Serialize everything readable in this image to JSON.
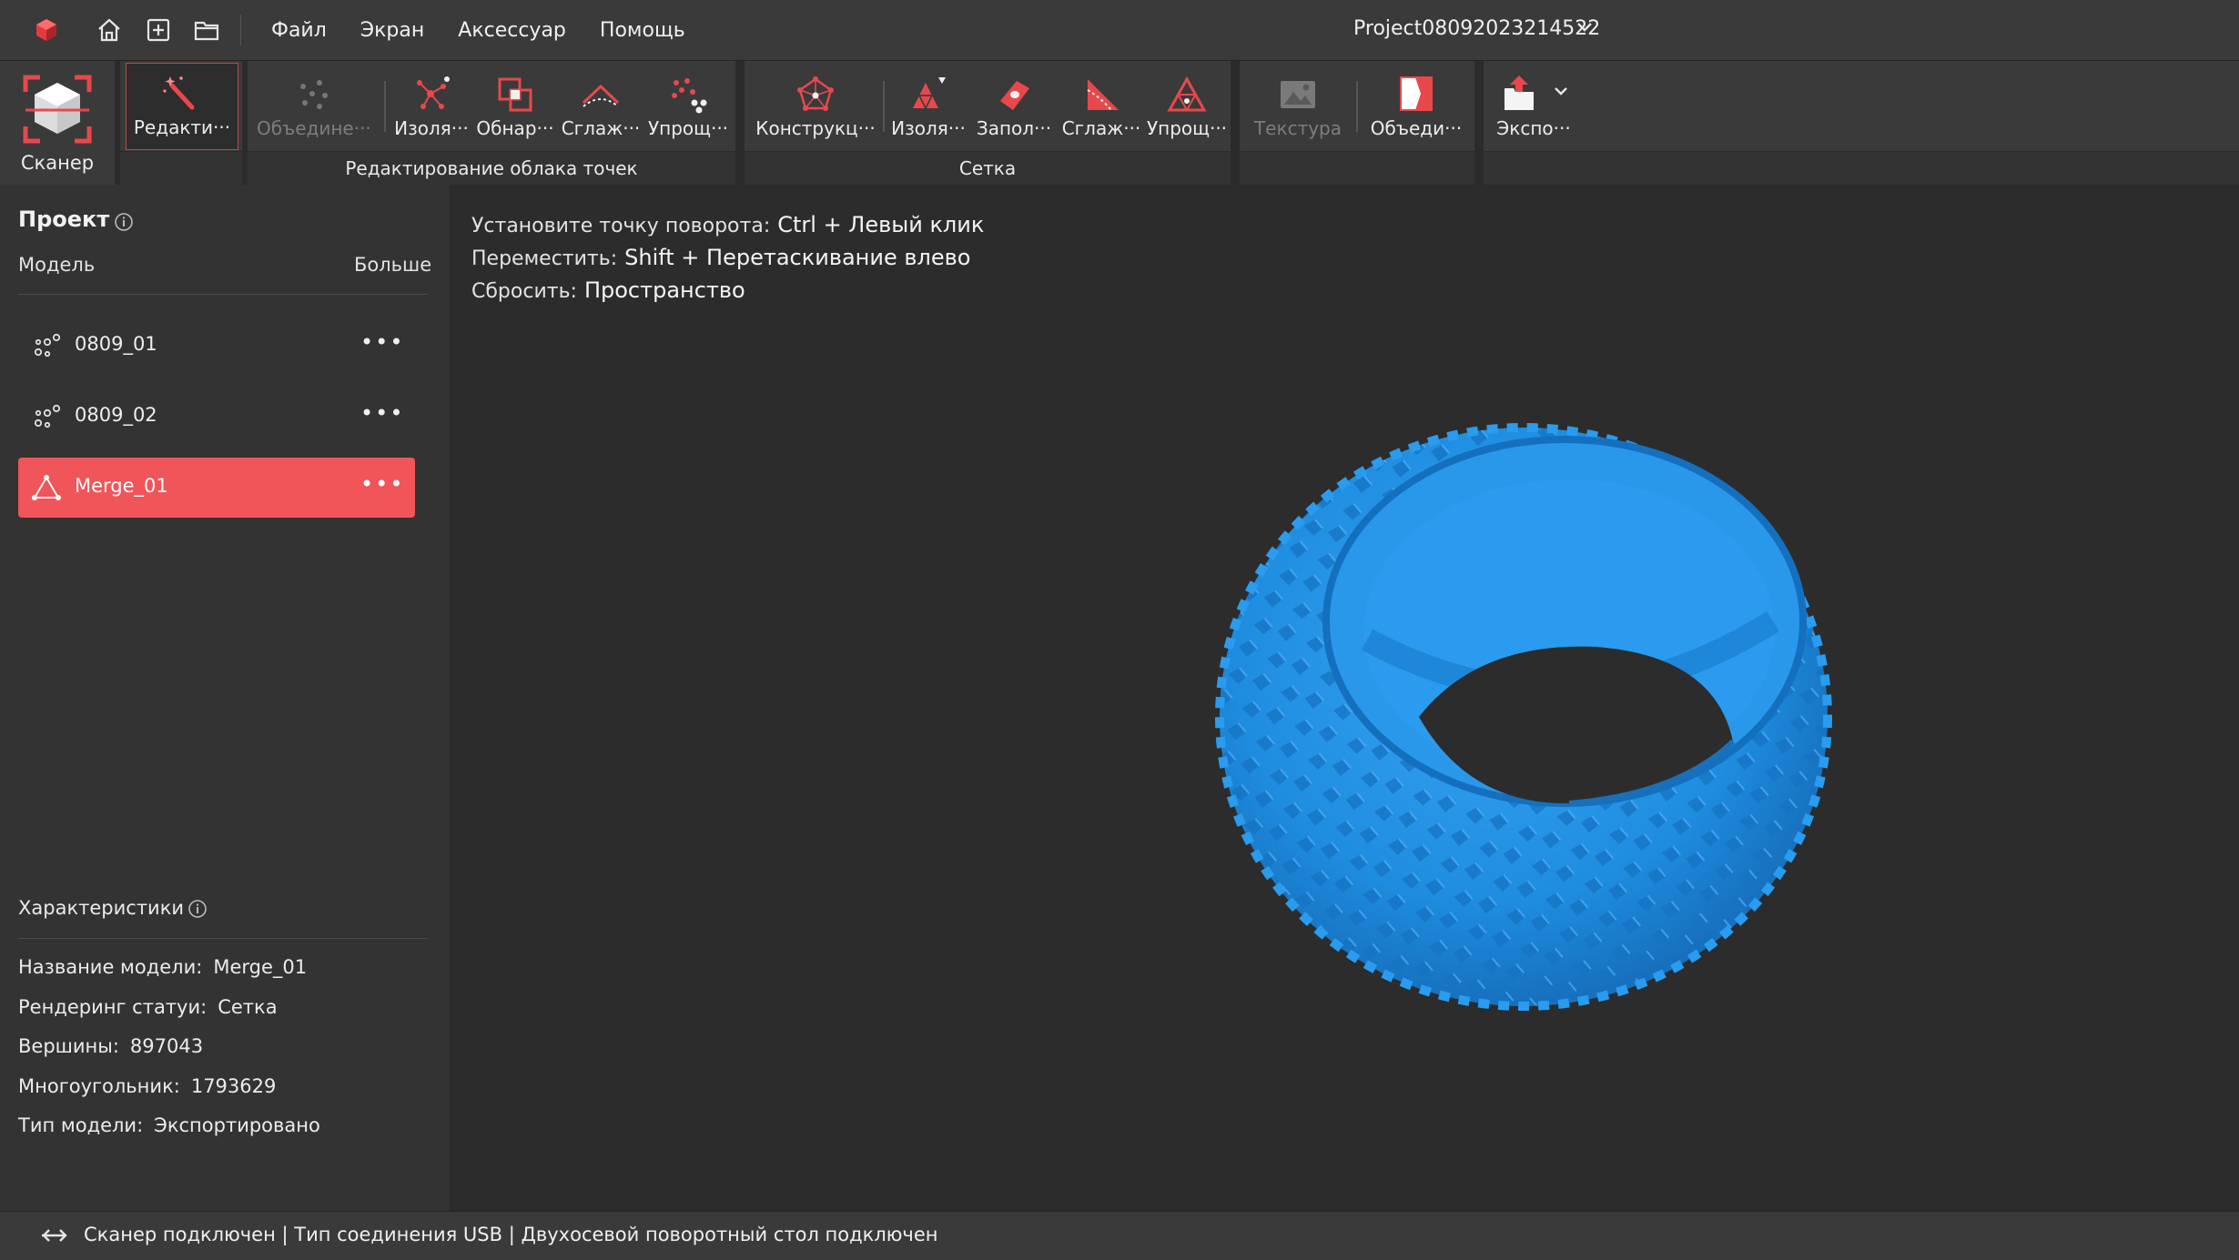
{
  "titlebar": {
    "menu": [
      "Файл",
      "Экран",
      "Аксессуар",
      "Помощь"
    ],
    "project_name": "Project08092023214522"
  },
  "toolbar": {
    "scanner_label": "Сканер",
    "pointcloud_group_label": "Редактирование облака точек",
    "mesh_group_label": "Сетка",
    "tools": {
      "edit": "Редакти···",
      "merge_pc": "Объедине···",
      "isolate_pc": "Изоля···",
      "detect_pc": "Обнар···",
      "smooth_pc": "Сглаж···",
      "simplify_pc": "Упрощ···",
      "construct": "Конструкц···",
      "isolate_mesh": "Изоля···",
      "fill": "Запол···",
      "smooth_mesh": "Сглаж···",
      "simplify_mesh": "Упрощ···",
      "texture": "Текстура",
      "merge_mesh": "Объеди···",
      "export": "Экспо···"
    }
  },
  "project_panel": {
    "title": "Проект",
    "col_model": "Модель",
    "col_more": "Больше",
    "models": [
      {
        "name": "0809_01",
        "more": "•••",
        "icon": "point-cloud-icon"
      },
      {
        "name": "0809_02",
        "more": "•••",
        "icon": "point-cloud-icon"
      },
      {
        "name": "Merge_01",
        "more": "•••",
        "icon": "mesh-icon",
        "selected": true
      }
    ],
    "properties_title": "Характеристики",
    "properties": [
      {
        "key": "Название модели:",
        "value": "Merge_01"
      },
      {
        "key": "Рендеринг статуи:",
        "value": "Сетка"
      },
      {
        "key": "Вершины:",
        "value": "897043"
      },
      {
        "key": "Многоугольник:",
        "value": "1793629"
      },
      {
        "key": "Тип модели:",
        "value": "Экспортировано"
      }
    ]
  },
  "viewport": {
    "hints": [
      {
        "label": "Установите точку поворота:",
        "key": "Ctrl + Левый клик"
      },
      {
        "label": "Переместить:",
        "key": "Shift + Перетаскивание влево"
      },
      {
        "label": "Сбросить:",
        "key": "Пространство"
      }
    ],
    "model_color": "#1e8de0"
  },
  "statusbar": {
    "text": "Сканер подключен | Тип соединения USB  | Двухосевой поворотный стол подключен"
  },
  "colors": {
    "accent": "#e8484c",
    "selected_row": "#f0555a",
    "background": "#2c2c2c",
    "panel": "#333333"
  }
}
